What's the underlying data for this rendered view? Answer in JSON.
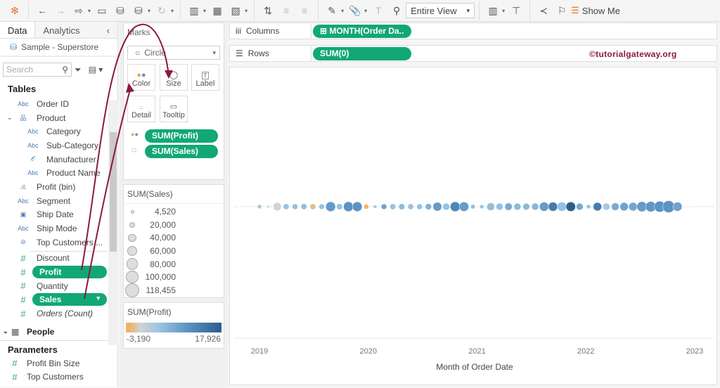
{
  "toolbar": {
    "view_select": "Entire View",
    "show_me": "Show Me",
    "icons": [
      "tableau-logo",
      "undo",
      "redo",
      "replay",
      "save",
      "new-datasource",
      "pause-updates",
      "refresh",
      "new-worksheet",
      "duplicate-sheet",
      "clear-sheet",
      "swap",
      "sort-asc",
      "sort-desc",
      "highlight",
      "group",
      "label",
      "pin",
      "cards",
      "presentation",
      "share",
      "annotate",
      "show-me"
    ]
  },
  "left": {
    "tabs": [
      "Data",
      "Analytics"
    ],
    "datasource": "Sample - Superstore",
    "search_placeholder": "Search",
    "tables_heading": "Tables",
    "fields": [
      {
        "label": "Order ID",
        "icon": "Abc",
        "indent": 1
      },
      {
        "label": "Product",
        "icon": "hierarchy",
        "indent": 0,
        "expander": true
      },
      {
        "label": "Category",
        "icon": "Abc",
        "indent": 2
      },
      {
        "label": "Sub-Category",
        "icon": "Abc",
        "indent": 2
      },
      {
        "label": "Manufacturer",
        "icon": "paperclip",
        "indent": 2
      },
      {
        "label": "Product Name",
        "icon": "Abc",
        "indent": 2
      },
      {
        "label": "Profit (bin)",
        "icon": "bin",
        "indent": 1
      },
      {
        "label": "Segment",
        "icon": "Abc",
        "indent": 1
      },
      {
        "label": "Ship Date",
        "icon": "calendar",
        "indent": 1
      },
      {
        "label": "Ship Mode",
        "icon": "Abc",
        "indent": 1
      },
      {
        "label": "Top Customers ...",
        "icon": "set",
        "indent": 1
      }
    ],
    "measures": [
      {
        "label": "Discount",
        "pill": false
      },
      {
        "label": "Profit",
        "pill": true
      },
      {
        "label": "Quantity",
        "pill": false
      },
      {
        "label": "Sales",
        "pill": true
      },
      {
        "label": "Orders (Count)",
        "pill": false,
        "italic": true
      }
    ],
    "people": "People",
    "parameters_heading": "Parameters",
    "parameters": [
      "Profit Bin Size",
      "Top Customers"
    ]
  },
  "marks": {
    "title": "Marks",
    "type": "Circle",
    "buttons": [
      "Color",
      "Size",
      "Label",
      "Detail",
      "Tooltip"
    ],
    "pills": [
      "SUM(Profit)",
      "SUM(Sales)"
    ]
  },
  "size_legend": {
    "title": "SUM(Sales)",
    "items": [
      "4,520",
      "20,000",
      "40,000",
      "60,000",
      "80,000",
      "100,000",
      "118,455"
    ],
    "values": [
      4520,
      20000,
      40000,
      60000,
      80000,
      100000,
      118455
    ]
  },
  "color_legend": {
    "title": "SUM(Profit)",
    "min": "-3,190",
    "max": "17,926",
    "colors": [
      "#f0b26b",
      "#cfd3d4",
      "#9ac4e0",
      "#5b93c4",
      "#2a5d8f"
    ]
  },
  "shelves": {
    "columns_label": "Columns",
    "columns_pill": "MONTH(Order Da..",
    "rows_label": "Rows",
    "rows_pill": "SUM(0)"
  },
  "watermark": "©tutorialgateway.org",
  "chart_data": {
    "type": "scatter",
    "xlabel": "Month of Order Date",
    "x_ticks": [
      "2019",
      "2020",
      "2021",
      "2022",
      "2023"
    ],
    "y_value": 0,
    "size_field": "SUM(Sales)",
    "color_field": "SUM(Profit)",
    "sales": [
      15000,
      4520,
      55000,
      28000,
      27000,
      28000,
      28000,
      25000,
      80000,
      30000,
      81000,
      78000,
      20000,
      10000,
      25000,
      28000,
      30000,
      27000,
      26000,
      32000,
      65000,
      40000,
      81000,
      75000,
      17000,
      14000,
      50000,
      40000,
      45000,
      40000,
      38000,
      40000,
      70000,
      70000,
      72000,
      75000,
      40000,
      15000,
      60000,
      42000,
      48000,
      58000,
      60000,
      85000,
      90000,
      100000,
      118455,
      70000
    ],
    "profit": [
      2000,
      0,
      0,
      3000,
      3000,
      3500,
      -2000,
      3000,
      8000,
      3000,
      9000,
      9000,
      -3190,
      2000,
      7000,
      3000,
      4000,
      3000,
      3000,
      5000,
      8000,
      3000,
      11000,
      8000,
      3000,
      3000,
      3500,
      3000,
      6000,
      4000,
      4000,
      4500,
      8000,
      13000,
      3000,
      17926,
      6000,
      3000,
      13000,
      2000,
      6000,
      7000,
      6500,
      8000,
      8500,
      9000,
      9000,
      7000
    ]
  }
}
